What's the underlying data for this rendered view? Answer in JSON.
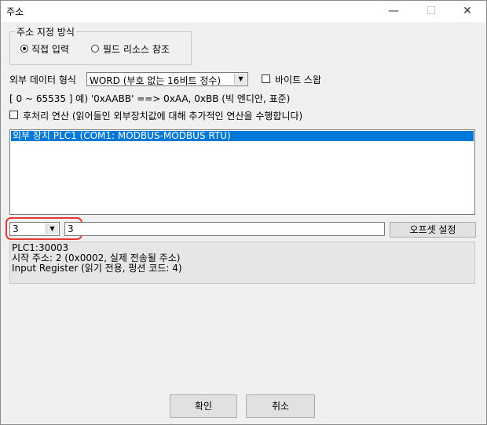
{
  "window": {
    "title": "주소",
    "minimize": "—",
    "maximize": "☐",
    "close": "✕"
  },
  "address_mode": {
    "group_label": "주소 지정 방식",
    "direct_input": "직접 입력",
    "field_resource": "필드 리소스 참조"
  },
  "external_format": {
    "label": "외부 데이터 형식",
    "selected": "WORD (부호 없는 16비트 정수)",
    "byte_swap_label": "바이트 스왑",
    "hint": "[ 0 ~ 65535 ]  예) '0xAABB' ==> 0xAA, 0xBB (빅 엔디안, 표준)"
  },
  "post_process": {
    "label": "후처리 연산 (읽어들인 외부장치값에 대해 추가적인 연산을 수행합니다)"
  },
  "device_list": {
    "items": [
      "외부 장치 PLC1 (COM1: MODBUS-MODBUS RTU)"
    ]
  },
  "address_entry": {
    "type_value": "3",
    "offset_value": "3",
    "offset_button": "오프셋 설정"
  },
  "info": {
    "line1": "PLC1:30003",
    "line2": "시작 주소: 2 (0x0002, 실제 전송될 주소)",
    "line3": "Input Register (읽기 전용, 펑션 코드: 4)"
  },
  "footer": {
    "ok": "확인",
    "cancel": "취소"
  },
  "colors": {
    "selection": "#0078d7",
    "highlight": "#e53935"
  }
}
